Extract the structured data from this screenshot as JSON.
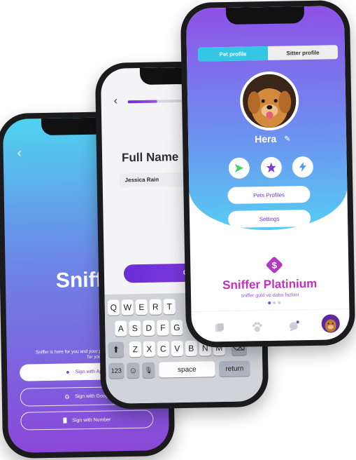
{
  "welcome_screen": {
    "back_icon": "chevron-left-icon",
    "brand": "Sniffe",
    "tagline": "Sniffer is here for you and your pe... you easily find friends for you",
    "buttons": [
      {
        "label": "Sign with App",
        "icon": "apple-icon"
      },
      {
        "label": "Sign with Goog",
        "icon": "google-icon"
      },
      {
        "label": "Sign with Number",
        "icon": "phone-icon"
      }
    ]
  },
  "name_screen": {
    "back_icon": "chevron-left-icon",
    "progress": 0.3,
    "field_label": "Full Name",
    "field_value": "Jessica Rain",
    "continue_label": "CONT",
    "keyboard": {
      "row1": [
        "Q",
        "W",
        "E",
        "R",
        "T"
      ],
      "row2": [
        "A",
        "S",
        "D",
        "F",
        "G"
      ],
      "row3": [
        "Z",
        "X",
        "C",
        "V",
        "B",
        "N",
        "M"
      ],
      "shift": "⬆",
      "delete": "⌫",
      "numbers": "123",
      "emoji": "☺",
      "mic": "🎙",
      "space": "space",
      "return": "return"
    }
  },
  "profile_screen": {
    "tabs": [
      "Pet profile",
      "Sitter profile"
    ],
    "active_tab": 0,
    "pet_name": "Hera",
    "edit_icon": "pencil-icon",
    "actions": [
      "send-icon",
      "star-icon",
      "bolt-icon"
    ],
    "accent": "#8e51e6",
    "buttons": [
      "Pets Profiles",
      "Settings"
    ],
    "platinum_title": "Sniffer Platinium",
    "platinum_subtitle": "sniffer gold ve daha fazlası",
    "nav": [
      "cards-icon",
      "paw-icon",
      "chat-icon",
      "profile-avatar"
    ]
  }
}
